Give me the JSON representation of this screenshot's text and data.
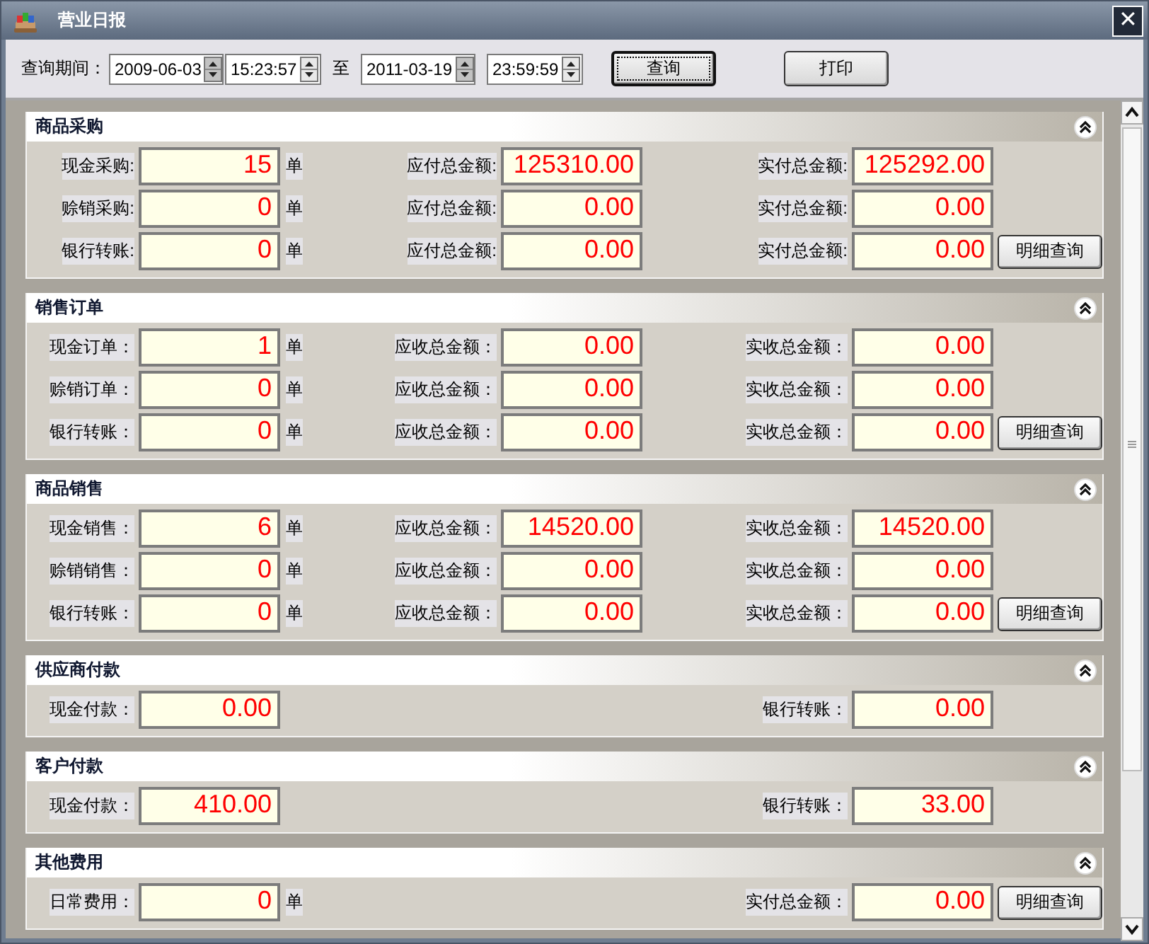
{
  "window": {
    "title": "营业日报",
    "close": "✕"
  },
  "query": {
    "label": "查询期间：",
    "from_date": "2009-06-03",
    "from_time": "15:23:57",
    "separator": "至",
    "to_date": "2011-03-19",
    "to_time": "23:59:59",
    "buttons": [
      {
        "label": "查询",
        "focused": true
      },
      {
        "label": "打印",
        "focused": false
      }
    ]
  },
  "sections": [
    {
      "title": "商品采购",
      "rows": [
        {
          "count": {
            "label": "现金采购:",
            "value": "15",
            "unit": "单"
          },
          "due": {
            "label": "应付总金额:",
            "value": "125310.00"
          },
          "paid": {
            "label": "实付总金额:",
            "value": "125292.00"
          }
        },
        {
          "count": {
            "label": "赊销采购:",
            "value": "0",
            "unit": "单"
          },
          "due": {
            "label": "应付总金额:",
            "value": "0.00"
          },
          "paid": {
            "label": "实付总金额:",
            "value": "0.00"
          }
        },
        {
          "count": {
            "label": "银行转账:",
            "value": "0",
            "unit": "单"
          },
          "due": {
            "label": "应付总金额:",
            "value": "0.00"
          },
          "paid": {
            "label": "实付总金额:",
            "value": "0.00"
          },
          "button": "明细查询"
        }
      ]
    },
    {
      "title": "销售订单",
      "rows": [
        {
          "count": {
            "label": "现金订单：",
            "value": "1",
            "unit": "单"
          },
          "due": {
            "label": "应收总金额：",
            "value": "0.00"
          },
          "paid": {
            "label": "实收总金额：",
            "value": "0.00"
          }
        },
        {
          "count": {
            "label": "赊销订单：",
            "value": "0",
            "unit": "单"
          },
          "due": {
            "label": "应收总金额：",
            "value": "0.00"
          },
          "paid": {
            "label": "实收总金额：",
            "value": "0.00"
          }
        },
        {
          "count": {
            "label": "银行转账：",
            "value": "0",
            "unit": "单"
          },
          "due": {
            "label": "应收总金额：",
            "value": "0.00"
          },
          "paid": {
            "label": "实收总金额：",
            "value": "0.00"
          },
          "button": "明细查询"
        }
      ]
    },
    {
      "title": "商品销售",
      "rows": [
        {
          "count": {
            "label": "现金销售：",
            "value": "6",
            "unit": "单"
          },
          "due": {
            "label": "应收总金额：",
            "value": "14520.00"
          },
          "paid": {
            "label": "实收总金额：",
            "value": "14520.00"
          }
        },
        {
          "count": {
            "label": "赊销销售：",
            "value": "0",
            "unit": "单"
          },
          "due": {
            "label": "应收总金额：",
            "value": "0.00"
          },
          "paid": {
            "label": "实收总金额：",
            "value": "0.00"
          }
        },
        {
          "count": {
            "label": "银行转账：",
            "value": "0",
            "unit": "单"
          },
          "due": {
            "label": "应收总金额：",
            "value": "0.00"
          },
          "paid": {
            "label": "实收总金额：",
            "value": "0.00"
          },
          "button": "明细查询"
        }
      ]
    },
    {
      "title": "供应商付款",
      "rows": [
        {
          "count": {
            "label": "现金付款：",
            "value": "0.00"
          },
          "paid": {
            "label": "银行转账：",
            "value": "0.00"
          }
        }
      ]
    },
    {
      "title": "客户付款",
      "rows": [
        {
          "count": {
            "label": "现金付款：",
            "value": "410.00"
          },
          "paid": {
            "label": "银行转账：",
            "value": "33.00"
          }
        }
      ]
    },
    {
      "title": "其他费用",
      "rows": [
        {
          "count": {
            "label": "日常费用：",
            "value": "0",
            "unit": "单"
          },
          "paid": {
            "label": "实付总金额：",
            "value": "0.00"
          },
          "button": "明细查询"
        }
      ]
    }
  ]
}
